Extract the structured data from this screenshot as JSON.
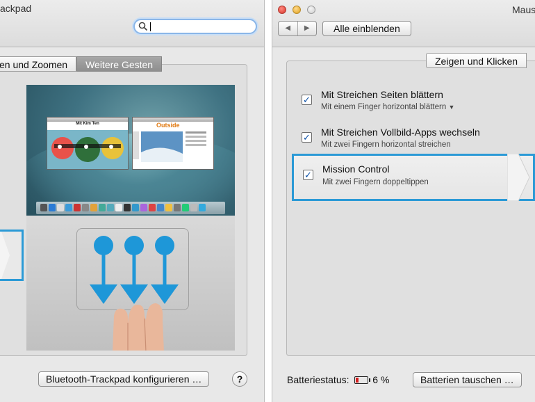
{
  "left_window": {
    "title": "ackpad",
    "tabs": [
      "en und Zoomen",
      "Weitere Gesten"
    ],
    "preview": {
      "thumb_a_title": "Mit Kim Ten",
      "thumb_b_title": "Outside"
    },
    "configure_button": "Bluetooth-Trackpad konfigurieren …",
    "help_button": "?"
  },
  "right_window": {
    "title": "Maus",
    "show_all_button": "Alle einblenden",
    "tab": "Zeigen und Klicken",
    "items": [
      {
        "title": "Mit Streichen Seiten blättern",
        "subtitle": "Mit einem Finger horizontal blättern",
        "checked": true
      },
      {
        "title": "Mit Streichen Vollbild-Apps wechseln",
        "subtitle": "Mit zwei Fingern horizontal streichen",
        "checked": true
      },
      {
        "title": "Mission Control",
        "subtitle": "Mit zwei Fingern doppeltippen",
        "checked": true
      }
    ],
    "battery_label": "Batteriestatus:",
    "battery_value": "6 %",
    "battery_level": 0.06,
    "replace_batteries_button": "Batterien tauschen …"
  },
  "colors": {
    "accent": "#2b9ad6",
    "gesture_arrow": "#1e97d8"
  }
}
